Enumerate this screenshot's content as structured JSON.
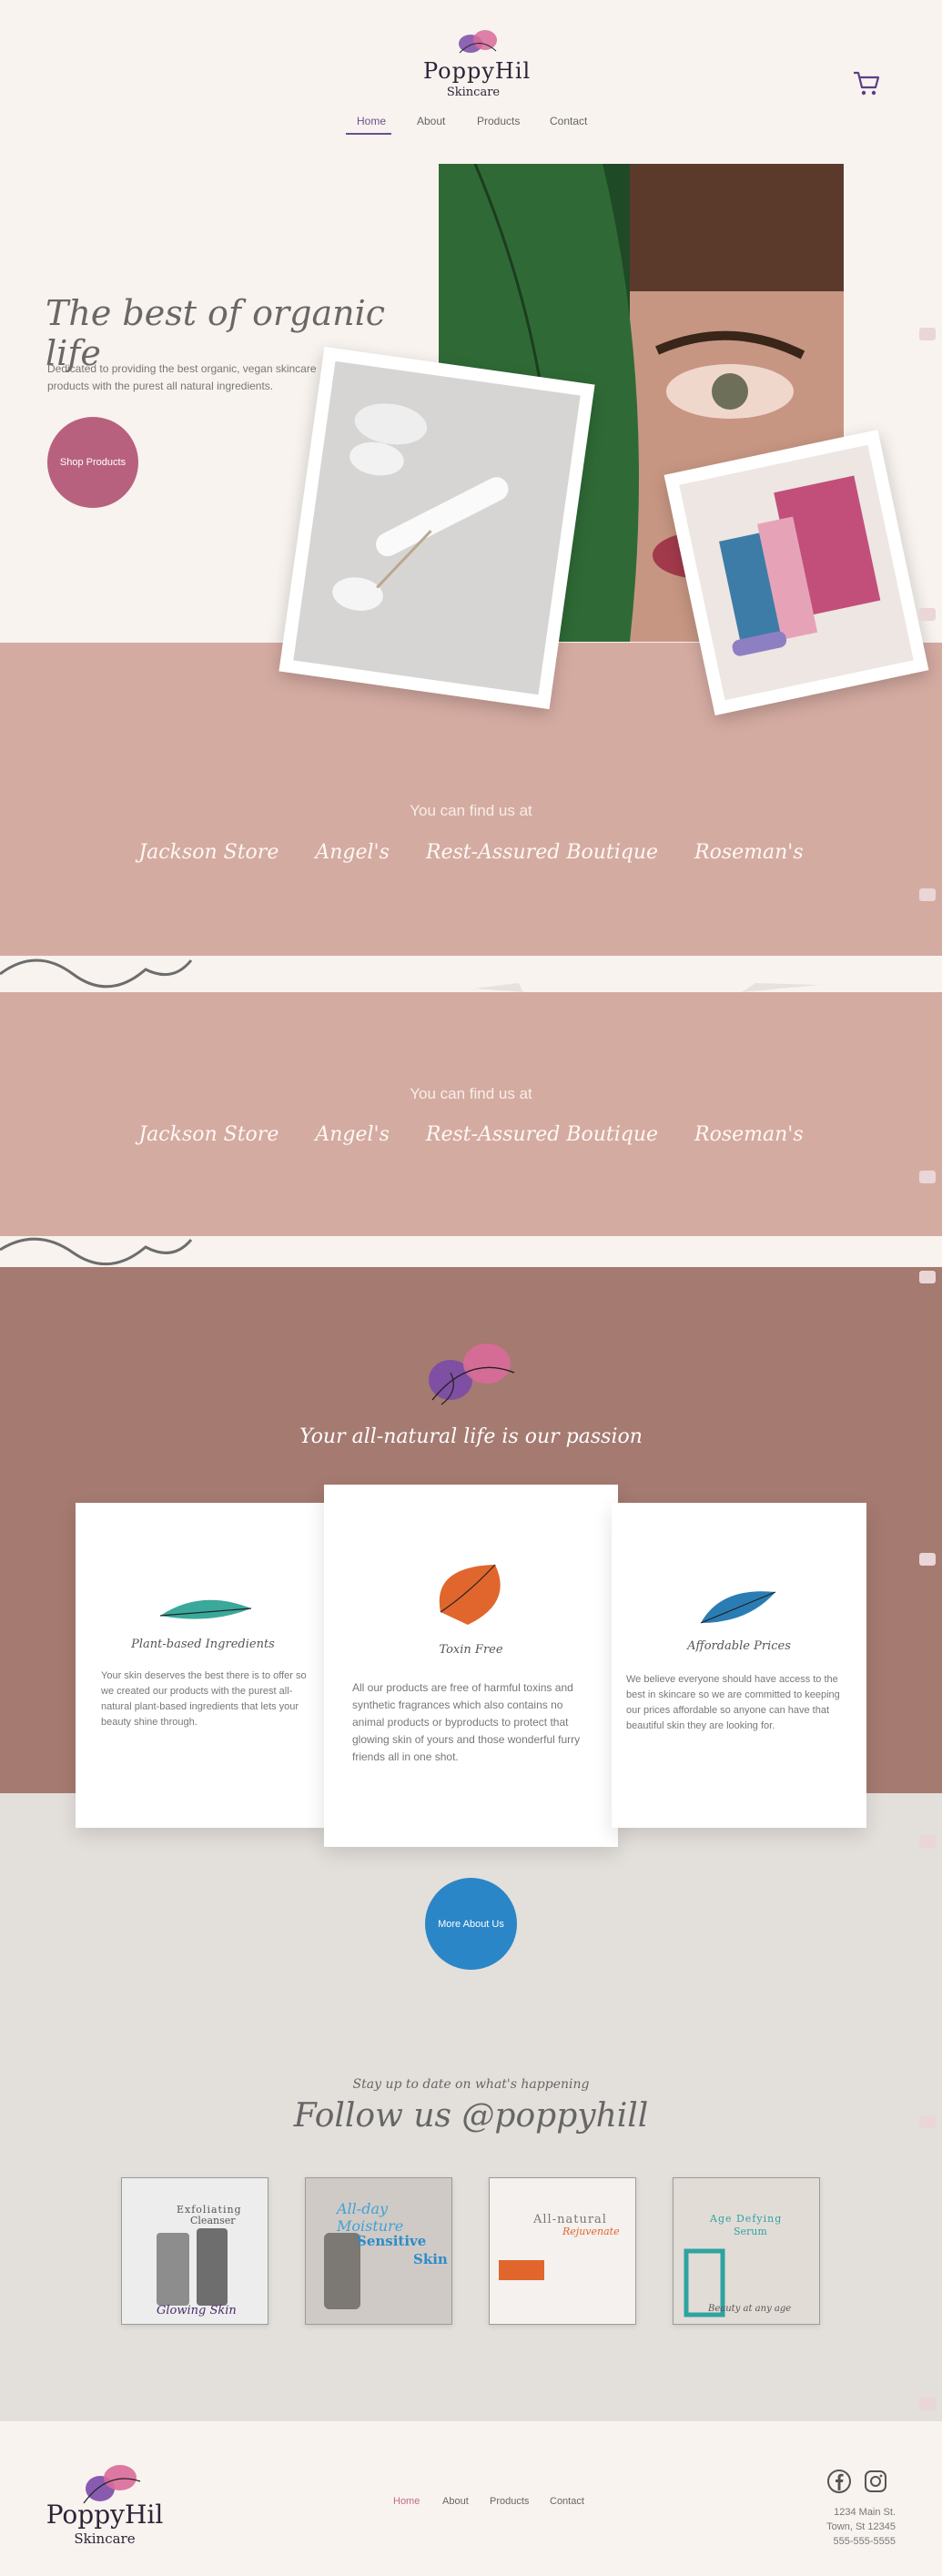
{
  "brand": {
    "name": "PoppyHil",
    "sub": "Skincare"
  },
  "nav": [
    "Home",
    "About",
    "Products",
    "Contact"
  ],
  "hero": {
    "title": "The best of organic life",
    "description": "Dedicated to providing the best organic, vegan skincare products with the purest all natural ingredients.",
    "cta": "Shop Products"
  },
  "find_us": {
    "title": "You can find us at",
    "stores": [
      "Jackson Store",
      "Angel's",
      "Rest-Assured Boutique",
      "Roseman's"
    ]
  },
  "passion": {
    "title": "Your all-natural life is our passion",
    "cards": [
      {
        "title": "Plant-based Ingredients",
        "text": "Your skin deserves the best there is to offer so we created our products with the purest all-natural plant-based ingredients that lets your beauty shine through."
      },
      {
        "title": "Toxin Free",
        "text": "All our products are free of harmful toxins and synthetic fragrances which also contains no animal products or byproducts to protect  that glowing skin of yours and those wonderful furry friends all in one shot."
      },
      {
        "title": "Affordable Prices",
        "text": "We believe everyone should have access to the best in skincare so we are committed to keeping our prices affordable so anyone can have that beautiful skin they are looking for."
      }
    ],
    "cta": "More About Us"
  },
  "social": {
    "kicker": "Stay up to date on what's happening",
    "title": "Follow us @poppyhill",
    "posts": [
      {
        "line1": "Exfoliating",
        "line2": "Cleanser",
        "line3": "Glowing Skin"
      },
      {
        "line1": "All-day Moisture",
        "line2": "Sensitive",
        "line3": "Skin"
      },
      {
        "line1": "All-natural",
        "line2": "Rejuvenate",
        "line3": ""
      },
      {
        "line1": "Age Defying",
        "line2": "Serum",
        "line3": "Beauty at any age"
      }
    ]
  },
  "footer": {
    "nav": [
      "Home",
      "About",
      "Products",
      "Contact"
    ],
    "address": [
      "1234 Main St.",
      "Town, St 12345",
      "555-555-5555"
    ]
  },
  "colors": {
    "accent": "#6b4f8f",
    "rose": "#d4aba1",
    "brown": "#a57a70",
    "cta": "#b8617e",
    "blue": "#2b86c7"
  }
}
